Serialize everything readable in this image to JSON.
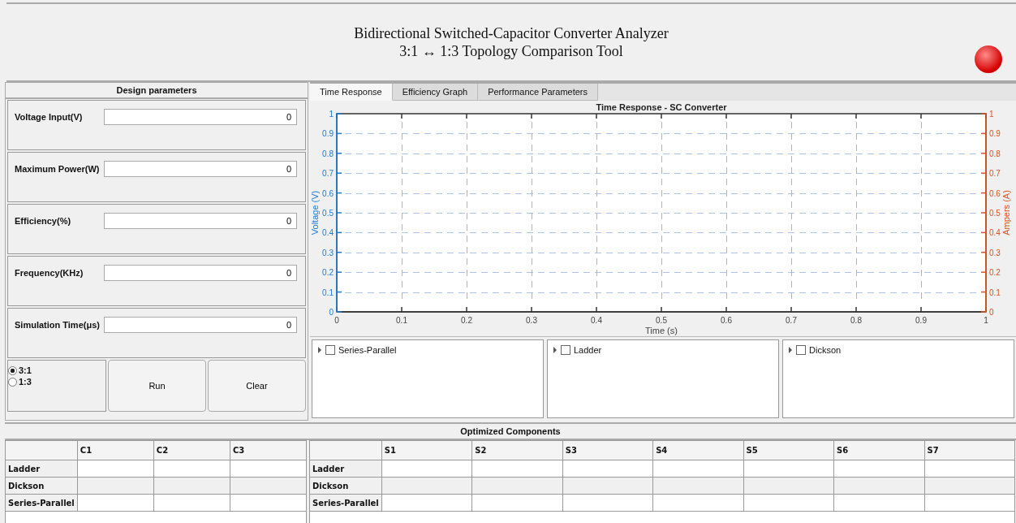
{
  "header": {
    "title_lines": [
      "Bidirectional Switched-Capacitor Converter Analyzer",
      "3:1 ↔ 1:3 Topology Comparison Tool"
    ],
    "lamp": {
      "on": true
    }
  },
  "design_parameters": {
    "title": "Design parameters",
    "fields": [
      {
        "label": "Voltage Input(V)",
        "value": "0"
      },
      {
        "label": "Maximum Power(W)",
        "value": "0"
      },
      {
        "label": "Efficiency(%)",
        "value": "0"
      },
      {
        "label": "Frequency(KHz)",
        "value": "0"
      },
      {
        "label": "Simulation Time(μs)",
        "value": "0"
      }
    ],
    "ratio_options": [
      {
        "label": "3:1",
        "selected": true
      },
      {
        "label": "1:3",
        "selected": false
      }
    ],
    "buttons": [
      "Run",
      "Clear"
    ]
  },
  "tabs": [
    {
      "label": "Time Response",
      "selected": true
    },
    {
      "label": "Efficiency Graph",
      "selected": false
    },
    {
      "label": "Performance Parameters",
      "selected": false
    }
  ],
  "chart_data": {
    "type": "line",
    "title": "Time Response - SC Converter",
    "xlabel": "Time (s)",
    "ylabel": "Voltage (V)",
    "y2label": "Ampers (A)",
    "xlim": [
      0,
      1
    ],
    "ylim": [
      0,
      1
    ],
    "y2lim": [
      0,
      1
    ],
    "grid": true,
    "xticks": [
      0,
      0.1,
      0.2,
      0.3,
      0.4,
      0.5,
      0.6,
      0.7,
      0.8,
      0.9,
      1
    ],
    "yticks": [
      0,
      0.1,
      0.2,
      0.3,
      0.4,
      0.5,
      0.6,
      0.7,
      0.8,
      0.9,
      1
    ],
    "y2ticks": [
      0,
      0.1,
      0.2,
      0.3,
      0.4,
      0.5,
      0.6,
      0.7,
      0.8,
      0.9,
      1
    ]
  },
  "topology_trees": [
    {
      "label": "Series-Parallel",
      "expanded": false,
      "checked": false
    },
    {
      "label": "Ladder",
      "expanded": false,
      "checked": false
    },
    {
      "label": "Dickson",
      "expanded": false,
      "checked": false
    }
  ],
  "optimized_components": {
    "title": "Optimized Components",
    "capacitor_table": {
      "columns": [
        "C1",
        "C2",
        "C3"
      ],
      "rows": [
        "Ladder",
        "Dickson",
        "Series-Parallel"
      ]
    },
    "switch_table": {
      "columns": [
        "S1",
        "S2",
        "S3",
        "S4",
        "S5",
        "S6",
        "S7"
      ],
      "rows": [
        "Ladder",
        "Dickson",
        "Series-Parallel"
      ]
    }
  }
}
